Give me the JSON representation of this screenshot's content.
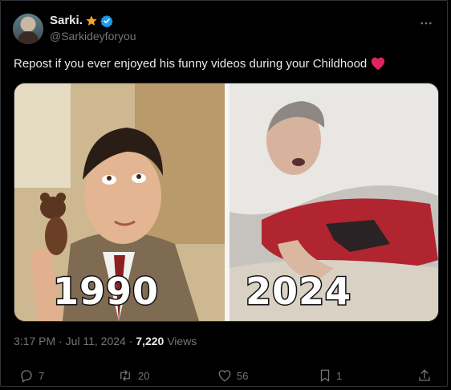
{
  "author": {
    "display_name": "Sarki.",
    "handle": "@Sarkideyforyou"
  },
  "tweet": {
    "text": "Repost if you ever enjoyed his funny videos during your Childhood"
  },
  "media": {
    "left_year": "1990",
    "right_year": "2024"
  },
  "meta": {
    "timestamp": "3:17 PM · Jul 11, 2024 · ",
    "views_count": "7,220",
    "views_label": " Views"
  },
  "actions": {
    "replies": "7",
    "reposts": "20",
    "likes": "56",
    "bookmarks": "1"
  },
  "colors": {
    "accent_blue": "#1d9bf0",
    "star_gold": "#f5a623",
    "heart_red": "#e0245e",
    "muted": "#71767b"
  }
}
